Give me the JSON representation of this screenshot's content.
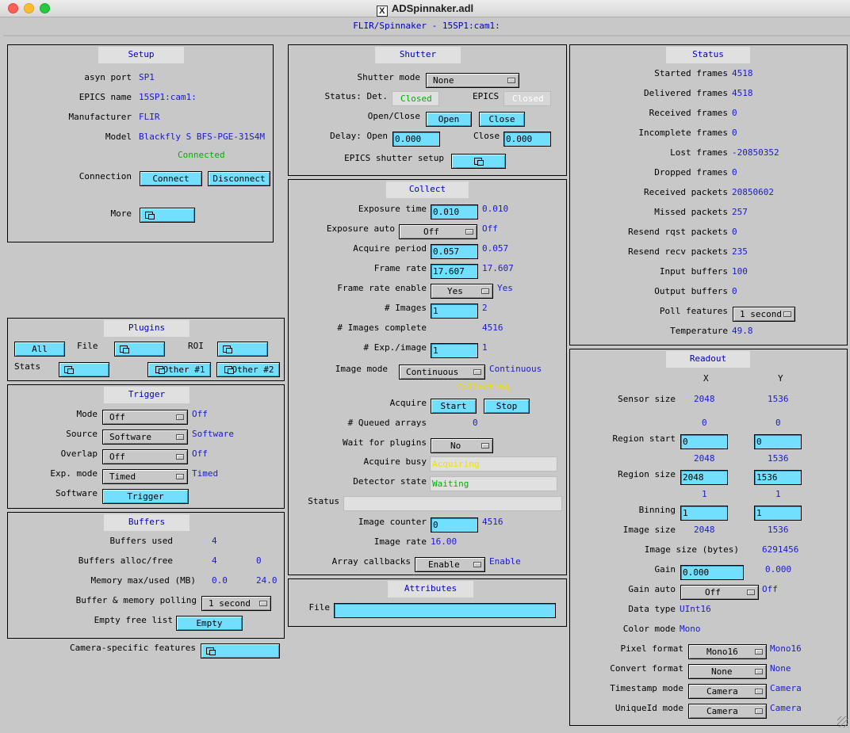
{
  "window": {
    "title": "ADSpinnaker.adl",
    "x_logo": "X",
    "subtitle": "FLIR/Spinnaker - 15SP1:cam1:"
  },
  "setup": {
    "title": "Setup",
    "asyn_port_label": "asyn port",
    "asyn_port": "SP1",
    "epics_name_label": "EPICS name",
    "epics_name": "15SP1:cam1:",
    "manufacturer_label": "Manufacturer",
    "manufacturer": "FLIR",
    "model_label": "Model",
    "model": "Blackfly S BFS-PGE-31S4M",
    "connection_status": "Connected",
    "connection_label": "Connection",
    "connect": "Connect",
    "disconnect": "Disconnect",
    "more_label": "More"
  },
  "plugins": {
    "title": "Plugins",
    "all": "All",
    "file_label": "File",
    "roi_label": "ROI",
    "stats_label": "Stats",
    "other1": "Other #1",
    "other2": "Other #2"
  },
  "trigger": {
    "title": "Trigger",
    "mode_label": "Mode",
    "mode": "Off",
    "mode_rbv": "Off",
    "source_label": "Source",
    "source": "Software",
    "source_rbv": "Software",
    "overlap_label": "Overlap",
    "overlap": "Off",
    "overlap_rbv": "Off",
    "exp_mode_label": "Exp. mode",
    "exp_mode": "Timed",
    "exp_mode_rbv": "Timed",
    "software_label": "Software",
    "trigger_btn": "Trigger"
  },
  "buffers": {
    "title": "Buffers",
    "used_label": "Buffers used",
    "used": "4",
    "alloc_label": "Buffers alloc/free",
    "alloc": "4",
    "free": "0",
    "mem_label": "Memory max/used (MB)",
    "mem_max": "0.0",
    "mem_used": "24.0",
    "polling_label": "Buffer & memory polling",
    "polling": "1 second",
    "empty_label": "Empty free list",
    "empty_btn": "Empty"
  },
  "camera_specific": {
    "label": "Camera-specific features"
  },
  "shutter": {
    "title": "Shutter",
    "mode_label": "Shutter mode",
    "mode": "None",
    "status_label": "Status: Det.",
    "det_status": "Closed",
    "epics_label": "EPICS",
    "epics_status": "Closed",
    "openclose_label": "Open/Close",
    "open_btn": "Open",
    "close_btn": "Close",
    "delay_label": "Delay: Open",
    "delay_open": "0.000",
    "close_label": "Close",
    "delay_close": "0.000",
    "epics_setup_label": "EPICS shutter setup"
  },
  "collect": {
    "title": "Collect",
    "exposure_time_label": "Exposure time",
    "exposure_time": "0.010",
    "exposure_time_rbv": "0.010",
    "exposure_auto_label": "Exposure auto",
    "exposure_auto": "Off",
    "exposure_auto_rbv": "Off",
    "acquire_period_label": "Acquire period",
    "acquire_period": "0.057",
    "acquire_period_rbv": "0.057",
    "frame_rate_label": "Frame rate",
    "frame_rate": "17.607",
    "frame_rate_rbv": "17.607",
    "frame_rate_enable_label": "Frame rate enable",
    "frame_rate_enable": "Yes",
    "frame_rate_enable_rbv": "Yes",
    "num_images_label": "# Images",
    "num_images": "1",
    "num_images_rbv": "2",
    "images_complete_label": "# Images complete",
    "images_complete": "4516",
    "exp_image_label": "# Exp./image",
    "exp_image": "1",
    "exp_image_rbv": "1",
    "image_mode_label": "Image mode",
    "image_mode": "Continuous",
    "image_mode_rbv": "Continuous",
    "collecting": "Collecting",
    "acquire_label": "Acquire",
    "start_btn": "Start",
    "stop_btn": "Stop",
    "queued_label": "# Queued arrays",
    "queued": "0",
    "wait_label": "Wait for plugins",
    "wait": "No",
    "acquire_busy_label": "Acquire busy",
    "acquire_busy": "Acquiring",
    "detector_state_label": "Detector state",
    "detector_state": "Waiting",
    "status_label": "Status",
    "status": "",
    "image_counter_label": "Image counter",
    "image_counter": "0",
    "image_counter_rbv": "4516",
    "image_rate_label": "Image rate",
    "image_rate": "16.00",
    "array_callbacks_label": "Array callbacks",
    "array_callbacks": "Enable",
    "array_callbacks_rbv": "Enable"
  },
  "attributes": {
    "title": "Attributes",
    "file_label": "File",
    "file": ""
  },
  "status": {
    "title": "Status",
    "started_label": "Started frames",
    "started": "4518",
    "delivered_label": "Delivered frames",
    "delivered": "4518",
    "received_label": "Received frames",
    "received": "0",
    "incomplete_label": "Incomplete frames",
    "incomplete": "0",
    "lost_label": "Lost frames",
    "lost": "-20850352",
    "dropped_label": "Dropped frames",
    "dropped": "0",
    "rx_packets_label": "Received packets",
    "rx_packets": "20850602",
    "missed_label": "Missed packets",
    "missed": "257",
    "resend_rqst_label": "Resend rqst packets",
    "resend_rqst": "0",
    "resend_recv_label": "Resend recv packets",
    "resend_recv": "235",
    "input_buffers_label": "Input buffers",
    "input_buffers": "100",
    "output_buffers_label": "Output buffers",
    "output_buffers": "0",
    "poll_label": "Poll features",
    "poll": "1 second",
    "temp_label": "Temperature",
    "temp": "49.8"
  },
  "readout": {
    "title": "Readout",
    "x_head": "X",
    "y_head": "Y",
    "sensor_label": "Sensor size",
    "sensor_x": "2048",
    "sensor_y": "1536",
    "start_x_rbv": "0",
    "start_y_rbv": "0",
    "region_start_label": "Region start",
    "start_x": "0",
    "start_y": "0",
    "size_x_rbv": "2048",
    "size_y_rbv": "1536",
    "region_size_label": "Region size",
    "size_x": "2048",
    "size_y": "1536",
    "bin_x_rbv": "1",
    "bin_y_rbv": "1",
    "binning_label": "Binning",
    "bin_x": "1",
    "bin_y": "1",
    "image_size_label": "Image size",
    "image_x": "2048",
    "image_y": "1536",
    "image_bytes_label": "Image size (bytes)",
    "image_bytes": "6291456",
    "gain_label": "Gain",
    "gain": "0.000",
    "gain_rbv": "0.000",
    "gain_auto_label": "Gain auto",
    "gain_auto": "Off",
    "gain_auto_rbv": "Off",
    "data_type_label": "Data type",
    "data_type": "UInt16",
    "color_mode_label": "Color mode",
    "color_mode": "Mono",
    "pixel_format_label": "Pixel format",
    "pixel_format": "Mono16",
    "pixel_format_rbv": "Mono16",
    "convert_label": "Convert format",
    "convert": "None",
    "convert_rbv": "None",
    "timestamp_label": "Timestamp mode",
    "timestamp": "Camera",
    "timestamp_rbv": "Camera",
    "uniqueid_label": "UniqueId mode",
    "uniqueid": "Camera",
    "uniqueid_rbv": "Camera"
  },
  "colors": {
    "panel_bg": "#c8c8c8",
    "button": "#73dfff",
    "value_text": "#1a1ad0",
    "ok_text": "#00b000",
    "busy_text": "#f0e000"
  }
}
